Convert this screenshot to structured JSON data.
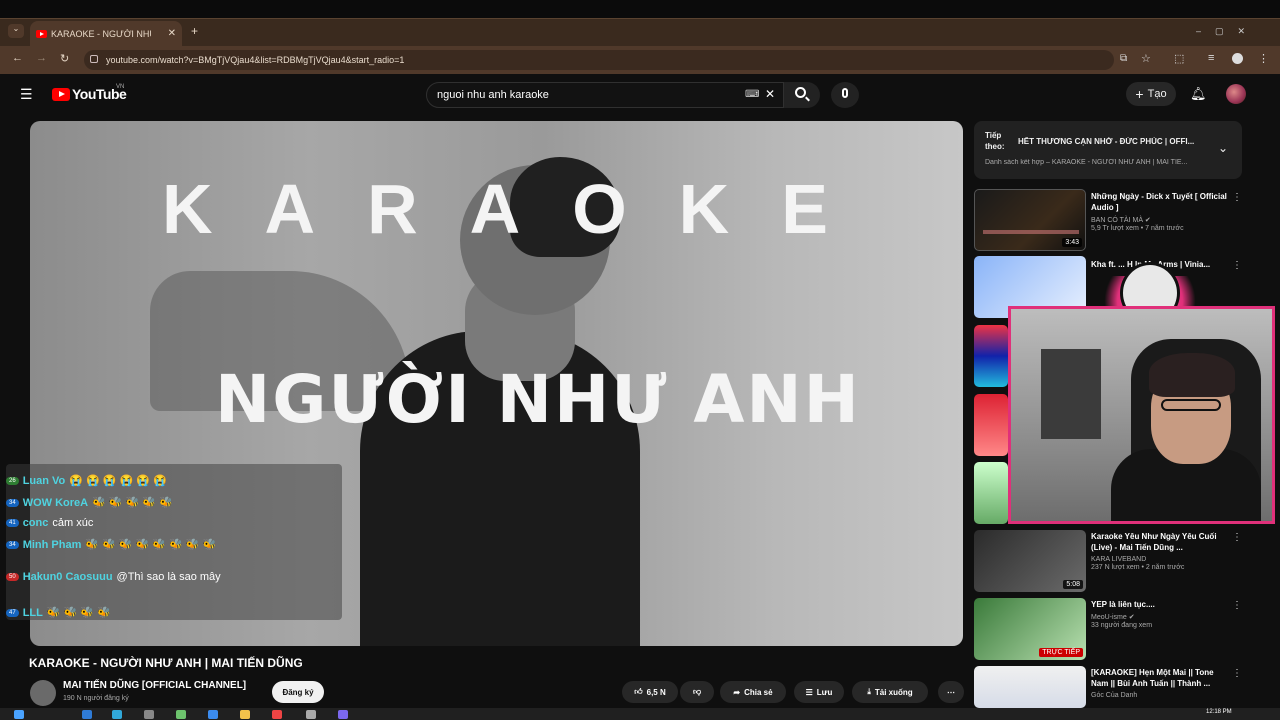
{
  "browser": {
    "tab_title": "KARAOKE - NGƯỜI NHƯ A...",
    "url": "youtube.com/watch?v=BMgTjVQjau4&list=RDBMgTjVQjau4&start_radio=1",
    "new_tab": "+",
    "tab_close": "✕",
    "back": "←",
    "forward": "→",
    "reload": "↻"
  },
  "youtube": {
    "logo": "YouTube",
    "region": "VN",
    "search_value": "nguoi nhu anh karaoke",
    "create_label": "Tạo"
  },
  "video": {
    "overlay_karaoke": "KARAOKE",
    "overlay_song": "NGƯỜI NHƯ ANH",
    "title": "KARAOKE - NGƯỜI NHƯ ANH | MAI TIẾN DŨNG",
    "channel": "MAI TIẾN DŨNG [OFFICIAL CHANNEL]",
    "subs": "190 N người đăng ký",
    "subscribe": "Đăng ký",
    "likes": "6,5 N",
    "share": "Chia sẻ",
    "save": "Lưu",
    "download": "Tải xuống",
    "more": "⋯"
  },
  "chat": [
    {
      "badge": "26",
      "name": "Luan Vo",
      "msg": "😭 😭 😭 😭 😭 😭"
    },
    {
      "badge": "34",
      "name": "WOW KoreA",
      "msg": "🐝 🐝 🐝 🐝 🐝"
    },
    {
      "badge": "41",
      "name": "conc",
      "msg": "cảm xúc"
    },
    {
      "badge": "34",
      "name": "Minh Pham",
      "msg": "🐝 🐝 🐝 🐝 🐝 🐝 🐝 🐝"
    },
    {
      "badge": "50",
      "name": "Hakun0 Caosuuu",
      "msg": "@Thì sao là sao mây"
    },
    {
      "badge": "47",
      "name": "LLL",
      "msg": "🐝 🐝 🐝 🐝"
    }
  ],
  "upnext": {
    "label": "Tiếp theo:",
    "title": "HẾT THƯƠNG CẠN NHỚ - ĐỨC PHÚC | OFFI...",
    "sub": "Danh sách kết hợp – KARAOKE - NGƯỜI NHƯ ANH | MAI TIẾ..."
  },
  "recs": [
    {
      "title": "Những Ngày - Dick x Tuyết [ Official Audio ]",
      "channel": "BAN CÓ TÀI MÀ ✔",
      "views": "5,9 Tr lượt xem • 7 năm trước",
      "duration": "3:43"
    },
    {
      "title": "Kha ft. ... H In My Arms | Vinia...",
      "channel": "",
      "views": "",
      "duration": ""
    },
    {
      "title": "Karaoke Yêu Như Ngày Yêu Cuối (Live) - Mai Tiến Dũng ...",
      "channel": "KARA LIVEBAND",
      "views": "237 N lượt xem • 2 năm trước",
      "duration": "5:08"
    },
    {
      "title": "YEP là liên tục....",
      "channel": "MeoU-isme ✔",
      "views": "33 người đang xem",
      "duration": "TRỰC TIẾP"
    },
    {
      "title": "[KARAOKE] Hẹn Một Mai || Tone Nam || Bùi Anh Tuấn || Thành ...",
      "channel": "Góc Của Danh",
      "views": "",
      "duration": ""
    }
  ],
  "taskbar": {
    "time": "12:18 PM"
  },
  "colors": {
    "accent": "#ff0000",
    "cam_border": "#e0307a",
    "chrome": "#50392a"
  }
}
